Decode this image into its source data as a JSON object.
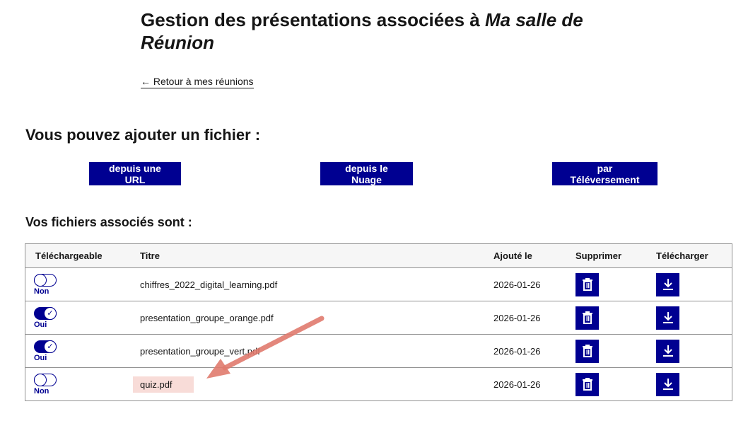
{
  "title": {
    "prefix": "Gestion des présentations associées à ",
    "room": "Ma salle de Réunion"
  },
  "back_link": "← Retour à mes réunions",
  "add_section": {
    "heading": "Vous pouvez ajouter un fichier :",
    "buttons": [
      "depuis une URL",
      "depuis le Nuage",
      "par Téléversement"
    ]
  },
  "files_section": {
    "heading": "Vos fichiers associés sont :",
    "columns": [
      "Téléchargeable",
      "Titre",
      "Ajouté le",
      "Supprimer",
      "Télécharger"
    ],
    "rows": [
      {
        "downloadable": "Non",
        "on": false,
        "title": "chiffres_2022_digital_learning.pdf",
        "date": "2026-01-26"
      },
      {
        "downloadable": "Oui",
        "on": true,
        "title": "presentation_groupe_orange.pdf",
        "date": "2026-01-26"
      },
      {
        "downloadable": "Oui",
        "on": true,
        "title": "presentation_groupe_vert.pdf",
        "date": "2026-01-26"
      },
      {
        "downloadable": "Non",
        "on": false,
        "title": "quiz.pdf",
        "date": "2026-01-26"
      }
    ]
  },
  "colors": {
    "primary": "#000091",
    "highlight": "#f8dcd8",
    "annotation_arrow": "#e07b6e"
  },
  "icons": {
    "delete": "trash-icon",
    "download": "download-icon",
    "toggle_check": "check-icon"
  }
}
